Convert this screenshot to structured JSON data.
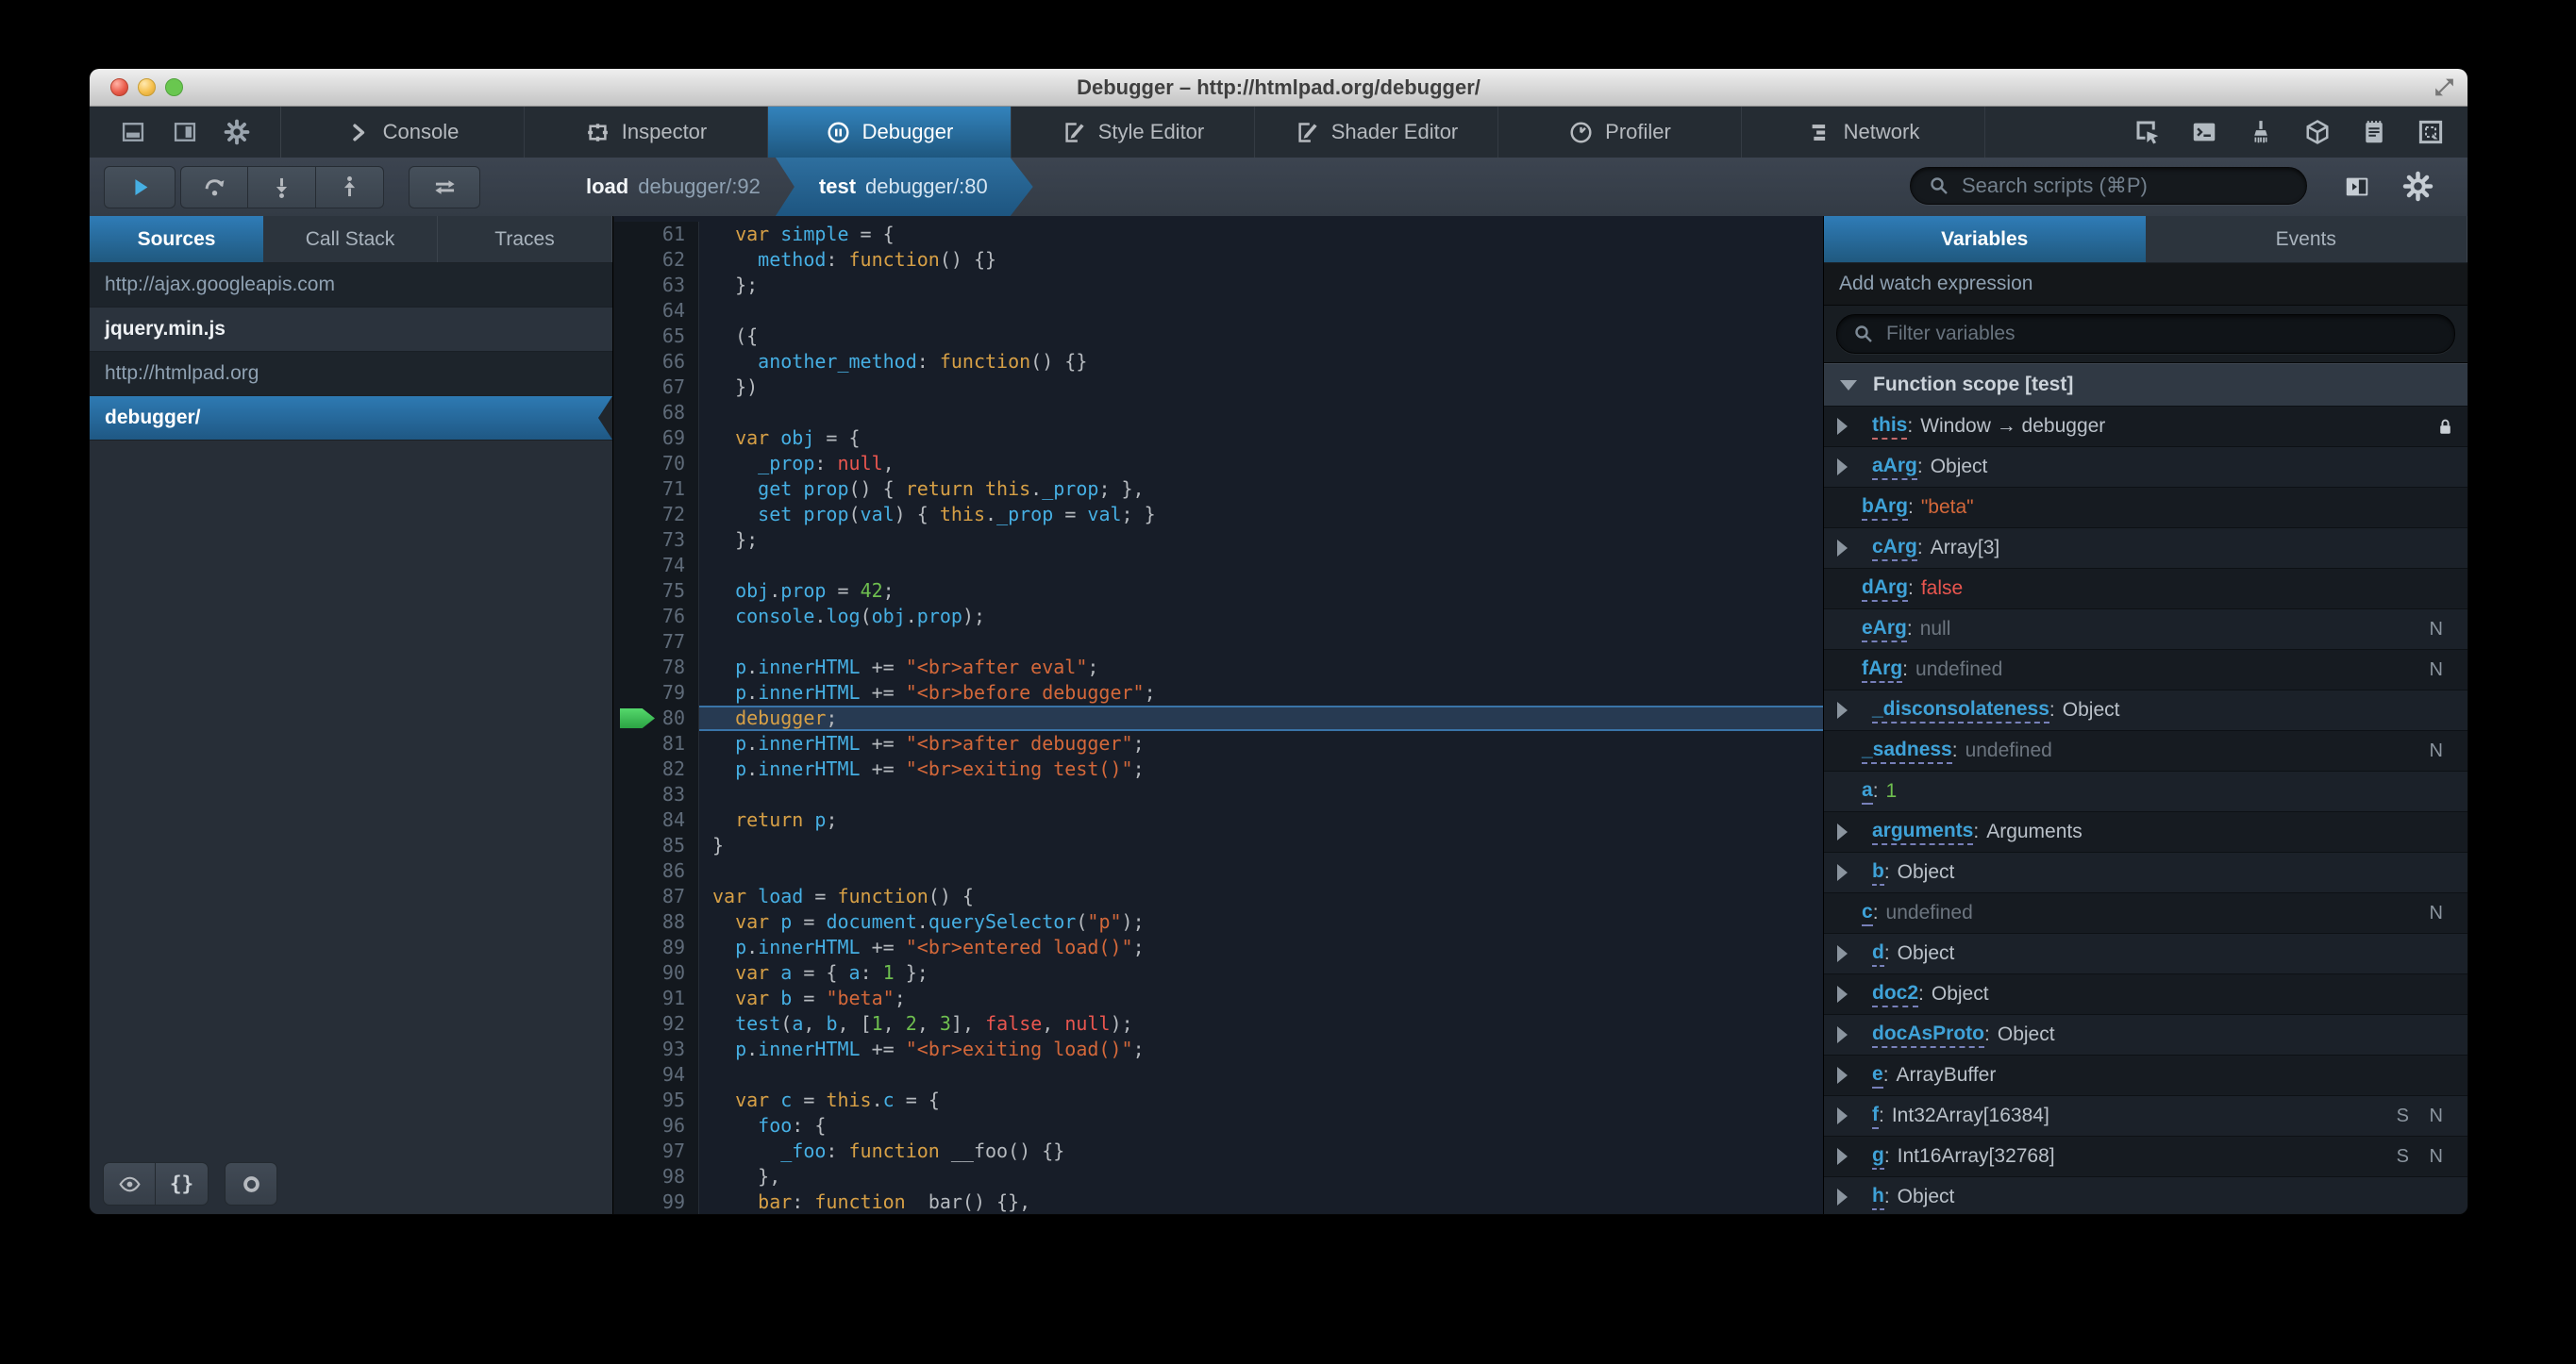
{
  "window": {
    "title": "Debugger – http://htmlpad.org/debugger/"
  },
  "colors": {
    "accent_blue": "#46afe3",
    "selection_blue": "#1d4f73",
    "string_orange": "#d96629",
    "keyword_tan": "#d99b28",
    "number_green": "#70bf53",
    "error_red": "#eb5368",
    "paused_arrow_green": "#3ccc5a"
  },
  "tabstrip": {
    "toolbox_buttons": [
      {
        "name": "dock-bottom-button",
        "icon": "dock-bottom"
      },
      {
        "name": "dock-side-button",
        "icon": "dock-side"
      },
      {
        "name": "toolbox-options-button",
        "icon": "gear"
      }
    ],
    "tabs": [
      {
        "label": "Console",
        "icon": "console",
        "active": false
      },
      {
        "label": "Inspector",
        "icon": "inspector",
        "active": false
      },
      {
        "label": "Debugger",
        "icon": "pause-circle",
        "active": true
      },
      {
        "label": "Style Editor",
        "icon": "pen-doc",
        "active": false
      },
      {
        "label": "Shader Editor",
        "icon": "pen-doc",
        "active": false
      },
      {
        "label": "Profiler",
        "icon": "clock",
        "active": false
      },
      {
        "label": "Network",
        "icon": "bars",
        "active": false
      }
    ],
    "right_buttons": [
      {
        "name": "pick-element-button",
        "icon": "pick-element"
      },
      {
        "name": "split-console-button",
        "icon": "split-console"
      },
      {
        "name": "paintbrush-button",
        "icon": "paintbrush"
      },
      {
        "name": "tilt-3d-button",
        "icon": "box-3d"
      },
      {
        "name": "scratchpad-button",
        "icon": "scratchpad"
      },
      {
        "name": "responsive-mode-button",
        "icon": "responsive"
      }
    ]
  },
  "toolbar": {
    "breadcrumbs": [
      {
        "fn": "load",
        "loc": "debugger/:92",
        "active": false
      },
      {
        "fn": "test",
        "loc": "debugger/:80",
        "active": true
      }
    ],
    "search_placeholder": "Search scripts (⌘P)"
  },
  "sources": {
    "tabs": [
      {
        "label": "Sources",
        "active": true
      },
      {
        "label": "Call Stack",
        "active": false
      },
      {
        "label": "Traces",
        "active": false
      }
    ],
    "items": [
      {
        "text": "http://ajax.googleapis.com",
        "type": "group",
        "selected": false
      },
      {
        "text": "jquery.min.js",
        "type": "file",
        "selected": false
      },
      {
        "text": "http://htmlpad.org",
        "type": "group",
        "selected": false
      },
      {
        "text": "debugger/",
        "type": "file",
        "selected": true
      }
    ],
    "footer_buttons": [
      {
        "name": "eye-button",
        "icon": "eye"
      },
      {
        "name": "pretty-print-button",
        "icon": "braces"
      },
      {
        "name": "blackbox-button",
        "icon": "circle"
      }
    ]
  },
  "editor": {
    "lines": [
      {
        "n": 61,
        "t": [
          [
            "p",
            "  "
          ],
          [
            "k",
            "var "
          ],
          [
            "i",
            "simple"
          ],
          [
            "p",
            " = {"
          ]
        ]
      },
      {
        "n": 62,
        "t": [
          [
            "p",
            "    "
          ],
          [
            "i",
            "method"
          ],
          [
            "p",
            ": "
          ],
          [
            "k",
            "function"
          ],
          [
            "p",
            "() {}"
          ]
        ]
      },
      {
        "n": 63,
        "t": [
          [
            "p",
            "  };"
          ]
        ]
      },
      {
        "n": 64,
        "t": []
      },
      {
        "n": 65,
        "t": [
          [
            "p",
            "  ({"
          ]
        ]
      },
      {
        "n": 66,
        "t": [
          [
            "p",
            "    "
          ],
          [
            "i",
            "another_method"
          ],
          [
            "p",
            ": "
          ],
          [
            "k",
            "function"
          ],
          [
            "p",
            "() {}"
          ]
        ]
      },
      {
        "n": 67,
        "t": [
          [
            "p",
            "  })"
          ]
        ]
      },
      {
        "n": 68,
        "t": []
      },
      {
        "n": 69,
        "t": [
          [
            "p",
            "  "
          ],
          [
            "k",
            "var "
          ],
          [
            "i",
            "obj"
          ],
          [
            "p",
            " = {"
          ]
        ]
      },
      {
        "n": 70,
        "t": [
          [
            "p",
            "    "
          ],
          [
            "i",
            "_prop"
          ],
          [
            "p",
            ": "
          ],
          [
            "r",
            "null"
          ],
          [
            "p",
            ","
          ]
        ]
      },
      {
        "n": 71,
        "t": [
          [
            "p",
            "    "
          ],
          [
            "i",
            "get prop"
          ],
          [
            "p",
            "() { "
          ],
          [
            "k",
            "return this"
          ],
          [
            "p",
            "."
          ],
          [
            "i",
            "_prop"
          ],
          [
            "p",
            "; },"
          ]
        ]
      },
      {
        "n": 72,
        "t": [
          [
            "p",
            "    "
          ],
          [
            "i",
            "set prop"
          ],
          [
            "p",
            "("
          ],
          [
            "i",
            "val"
          ],
          [
            "p",
            ") { "
          ],
          [
            "k",
            "this"
          ],
          [
            "p",
            "."
          ],
          [
            "i",
            "_prop"
          ],
          [
            "p",
            " = "
          ],
          [
            "i",
            "val"
          ],
          [
            "p",
            "; }"
          ]
        ]
      },
      {
        "n": 73,
        "t": [
          [
            "p",
            "  };"
          ]
        ]
      },
      {
        "n": 74,
        "t": []
      },
      {
        "n": 75,
        "t": [
          [
            "p",
            "  "
          ],
          [
            "i",
            "obj"
          ],
          [
            "p",
            "."
          ],
          [
            "i",
            "prop"
          ],
          [
            "p",
            " = "
          ],
          [
            "n",
            "42"
          ],
          [
            "p",
            ";"
          ]
        ]
      },
      {
        "n": 76,
        "t": [
          [
            "p",
            "  "
          ],
          [
            "i",
            "console"
          ],
          [
            "p",
            "."
          ],
          [
            "i",
            "log"
          ],
          [
            "p",
            "("
          ],
          [
            "i",
            "obj"
          ],
          [
            "p",
            "."
          ],
          [
            "i",
            "prop"
          ],
          [
            "p",
            ");"
          ]
        ]
      },
      {
        "n": 77,
        "t": []
      },
      {
        "n": 78,
        "t": [
          [
            "p",
            "  "
          ],
          [
            "i",
            "p"
          ],
          [
            "p",
            "."
          ],
          [
            "i",
            "innerHTML"
          ],
          [
            "p",
            " += "
          ],
          [
            "s",
            "\"<br>after eval\""
          ],
          [
            "p",
            ";"
          ]
        ]
      },
      {
        "n": 79,
        "t": [
          [
            "p",
            "  "
          ],
          [
            "i",
            "p"
          ],
          [
            "p",
            "."
          ],
          [
            "i",
            "innerHTML"
          ],
          [
            "p",
            " += "
          ],
          [
            "s",
            "\"<br>before debugger\""
          ],
          [
            "p",
            ";"
          ]
        ]
      },
      {
        "n": 80,
        "hl": true,
        "t": [
          [
            "p",
            "  "
          ],
          [
            "k",
            "debugger"
          ],
          [
            "p",
            ";"
          ]
        ]
      },
      {
        "n": 81,
        "t": [
          [
            "p",
            "  "
          ],
          [
            "i",
            "p"
          ],
          [
            "p",
            "."
          ],
          [
            "i",
            "innerHTML"
          ],
          [
            "p",
            " += "
          ],
          [
            "s",
            "\"<br>after debugger\""
          ],
          [
            "p",
            ";"
          ]
        ]
      },
      {
        "n": 82,
        "t": [
          [
            "p",
            "  "
          ],
          [
            "i",
            "p"
          ],
          [
            "p",
            "."
          ],
          [
            "i",
            "innerHTML"
          ],
          [
            "p",
            " += "
          ],
          [
            "s",
            "\"<br>exiting test()\""
          ],
          [
            "p",
            ";"
          ]
        ]
      },
      {
        "n": 83,
        "t": []
      },
      {
        "n": 84,
        "t": [
          [
            "p",
            "  "
          ],
          [
            "k",
            "return "
          ],
          [
            "i",
            "p"
          ],
          [
            "p",
            ";"
          ]
        ]
      },
      {
        "n": 85,
        "t": [
          [
            "p",
            "}"
          ]
        ]
      },
      {
        "n": 86,
        "t": []
      },
      {
        "n": 87,
        "t": [
          [
            "k",
            "var "
          ],
          [
            "i",
            "load"
          ],
          [
            "p",
            " = "
          ],
          [
            "k",
            "function"
          ],
          [
            "p",
            "() {"
          ]
        ]
      },
      {
        "n": 88,
        "t": [
          [
            "p",
            "  "
          ],
          [
            "k",
            "var "
          ],
          [
            "i",
            "p"
          ],
          [
            "p",
            " = "
          ],
          [
            "i",
            "document"
          ],
          [
            "p",
            "."
          ],
          [
            "i",
            "querySelector"
          ],
          [
            "p",
            "("
          ],
          [
            "s",
            "\"p\""
          ],
          [
            "p",
            ");"
          ]
        ]
      },
      {
        "n": 89,
        "t": [
          [
            "p",
            "  "
          ],
          [
            "i",
            "p"
          ],
          [
            "p",
            "."
          ],
          [
            "i",
            "innerHTML"
          ],
          [
            "p",
            " += "
          ],
          [
            "s",
            "\"<br>entered load()\""
          ],
          [
            "p",
            ";"
          ]
        ]
      },
      {
        "n": 90,
        "t": [
          [
            "p",
            "  "
          ],
          [
            "k",
            "var "
          ],
          [
            "i",
            "a"
          ],
          [
            "p",
            " = { "
          ],
          [
            "i",
            "a"
          ],
          [
            "p",
            ": "
          ],
          [
            "n",
            "1"
          ],
          [
            "p",
            " };"
          ]
        ]
      },
      {
        "n": 91,
        "t": [
          [
            "p",
            "  "
          ],
          [
            "k",
            "var "
          ],
          [
            "i",
            "b"
          ],
          [
            "p",
            " = "
          ],
          [
            "s",
            "\"beta\""
          ],
          [
            "p",
            ";"
          ]
        ]
      },
      {
        "n": 92,
        "t": [
          [
            "p",
            "  "
          ],
          [
            "i",
            "test"
          ],
          [
            "p",
            "("
          ],
          [
            "i",
            "a"
          ],
          [
            "p",
            ", "
          ],
          [
            "i",
            "b"
          ],
          [
            "p",
            ", ["
          ],
          [
            "n",
            "1"
          ],
          [
            "p",
            ", "
          ],
          [
            "n",
            "2"
          ],
          [
            "p",
            ", "
          ],
          [
            "n",
            "3"
          ],
          [
            "p",
            "], "
          ],
          [
            "r",
            "false"
          ],
          [
            "p",
            ", "
          ],
          [
            "r",
            "null"
          ],
          [
            "p",
            ");"
          ]
        ]
      },
      {
        "n": 93,
        "t": [
          [
            "p",
            "  "
          ],
          [
            "i",
            "p"
          ],
          [
            "p",
            "."
          ],
          [
            "i",
            "innerHTML"
          ],
          [
            "p",
            " += "
          ],
          [
            "s",
            "\"<br>exiting load()\""
          ],
          [
            "p",
            ";"
          ]
        ]
      },
      {
        "n": 94,
        "t": []
      },
      {
        "n": 95,
        "t": [
          [
            "p",
            "  "
          ],
          [
            "k",
            "var "
          ],
          [
            "i",
            "c"
          ],
          [
            "p",
            " = "
          ],
          [
            "k",
            "this"
          ],
          [
            "p",
            "."
          ],
          [
            "i",
            "c"
          ],
          [
            "p",
            " = {"
          ]
        ]
      },
      {
        "n": 96,
        "t": [
          [
            "p",
            "    "
          ],
          [
            "i",
            "foo"
          ],
          [
            "p",
            ": {"
          ]
        ]
      },
      {
        "n": 97,
        "t": [
          [
            "p",
            "      "
          ],
          [
            "i",
            "_foo"
          ],
          [
            "p",
            ": "
          ],
          [
            "k",
            "function "
          ],
          [
            "p",
            "__foo() {}"
          ]
        ]
      },
      {
        "n": 98,
        "t": [
          [
            "p",
            "    },"
          ]
        ]
      },
      {
        "n": 99,
        "t": [
          [
            "p",
            "    "
          ],
          [
            "k",
            "bar"
          ],
          [
            "p",
            ": "
          ],
          [
            "k",
            "function  "
          ],
          [
            "p",
            "bar() {},"
          ]
        ]
      }
    ]
  },
  "variables": {
    "tabs": [
      {
        "label": "Variables",
        "active": true
      },
      {
        "label": "Events",
        "active": false
      }
    ],
    "watch_label": "Add watch expression",
    "filter_placeholder": "Filter variables",
    "scope_label": "Function scope [test]",
    "rows": [
      {
        "name": "this",
        "value": "Window → debugger",
        "cls": "t",
        "expand": true,
        "lock": true,
        "u": "red",
        "flags": ""
      },
      {
        "name": "aArg",
        "value": "Object",
        "cls": "t",
        "expand": true,
        "flags": ""
      },
      {
        "name": "bArg",
        "value": "\"beta\"",
        "cls": "s",
        "expand": false,
        "flags": ""
      },
      {
        "name": "cArg",
        "value": "Array[3]",
        "cls": "t",
        "expand": true,
        "flags": ""
      },
      {
        "name": "dArg",
        "value": "false",
        "cls": "r",
        "expand": false,
        "flags": ""
      },
      {
        "name": "eArg",
        "value": "null",
        "cls": "d",
        "expand": false,
        "flags": "N"
      },
      {
        "name": "fArg",
        "value": "undefined",
        "cls": "d",
        "expand": false,
        "flags": "N"
      },
      {
        "name": "_disconsolateness",
        "value": "Object",
        "cls": "t",
        "expand": true,
        "flags": ""
      },
      {
        "name": "_sadness",
        "value": "undefined",
        "cls": "d",
        "expand": false,
        "flags": "N"
      },
      {
        "name": "a",
        "value": "1",
        "cls": "n",
        "expand": false,
        "flags": ""
      },
      {
        "name": "arguments",
        "value": "Arguments",
        "cls": "t",
        "expand": true,
        "flags": ""
      },
      {
        "name": "b",
        "value": "Object",
        "cls": "t",
        "expand": true,
        "flags": ""
      },
      {
        "name": "c",
        "value": "undefined",
        "cls": "d",
        "expand": false,
        "flags": "N"
      },
      {
        "name": "d",
        "value": "Object",
        "cls": "t",
        "expand": true,
        "flags": ""
      },
      {
        "name": "doc2",
        "value": "Object",
        "cls": "t",
        "expand": true,
        "flags": ""
      },
      {
        "name": "docAsProto",
        "value": "Object",
        "cls": "t",
        "expand": true,
        "flags": ""
      },
      {
        "name": "e",
        "value": "ArrayBuffer",
        "cls": "t",
        "expand": true,
        "flags": ""
      },
      {
        "name": "f",
        "value": "Int32Array[16384]",
        "cls": "t",
        "expand": true,
        "flags": "S N"
      },
      {
        "name": "g",
        "value": "Int16Array[32768]",
        "cls": "t",
        "expand": true,
        "flags": "S N"
      },
      {
        "name": "h",
        "value": "Object",
        "cls": "t",
        "expand": true,
        "flags": ""
      }
    ]
  }
}
